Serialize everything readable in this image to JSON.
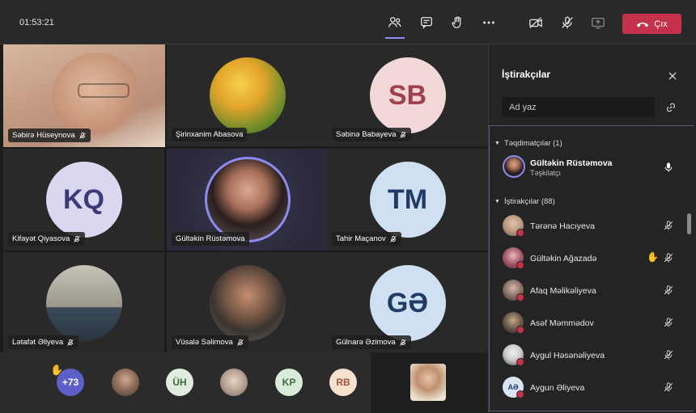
{
  "header": {
    "timer": "01:53:21",
    "leave_label": "Çıx",
    "accent": "#8b8cf0",
    "leave_color": "#c4314b"
  },
  "tiles": [
    {
      "name": "Səbirə Hüseynova",
      "type": "video",
      "color": "#c7a48a"
    },
    {
      "name": "Şirinxanim Abasova",
      "type": "photo",
      "color": "#e3a52a"
    },
    {
      "name": "Səbinə Babayeva",
      "type": "initials",
      "initials": "SB",
      "color": "#f2d7d9",
      "text_color": "#a0404e"
    },
    {
      "name": "Kifayət Qiyasova",
      "type": "initials",
      "initials": "KQ",
      "color": "#dcd7f0",
      "text_color": "#3d3a78"
    },
    {
      "name": "Gültəkin Rüstəmova",
      "type": "photo",
      "color": "#6b4a3e",
      "highlight": true
    },
    {
      "name": "Tahir Maçanov",
      "type": "initials",
      "initials": "TM",
      "color": "#cfe0f2",
      "text_color": "#1f3b66"
    },
    {
      "name": "Lətafət Əliyeva",
      "type": "photo",
      "color": "#b4b0a8"
    },
    {
      "name": "Vüsalə Səlimova",
      "type": "photo",
      "color": "#5a5048"
    },
    {
      "name": "Gülnarə Əzimova",
      "type": "initials",
      "initials": "GƏ",
      "color": "#cfe0f2",
      "text_color": "#1f3b66"
    }
  ],
  "strip": {
    "overflow_count": "+73",
    "avatars": [
      {
        "initials": "",
        "color": "#8a6a58"
      },
      {
        "initials": "ÜH",
        "color": "#e0ece0",
        "text_color": "#3d6b3d"
      },
      {
        "initials": "",
        "color": "#b7a294"
      },
      {
        "initials": "KP",
        "color": "#d9ecd9",
        "text_color": "#3d6b3d"
      },
      {
        "initials": "RB",
        "color": "#f6e1cf",
        "text_color": "#a0553a"
      }
    ]
  },
  "roster": {
    "title": "İştirakçılar",
    "search_placeholder": "Ad yaz",
    "presenters_label": "Təqdimatçılar (1)",
    "presenter": {
      "name": "Gültəkin Rüstəmova",
      "role": "Təşkilatçı"
    },
    "attendees_label": "İştirakçılar (88)",
    "attendees": [
      {
        "name": "Tərানə Hacıyeva",
        "initials": "",
        "color": "#b89a7e",
        "hand": false
      },
      {
        "name": "Gültəkin Ağazadə",
        "initials": "",
        "color": "#a45a6a",
        "hand": true
      },
      {
        "name": "Afaq Məlikəliyeva",
        "initials": "",
        "color": "#8a7068",
        "hand": false
      },
      {
        "name": "Asəf Məmmədov",
        "initials": "",
        "color": "#6a5a4a",
        "hand": false
      },
      {
        "name": "Aygul Həsənəliyeva",
        "initials": "",
        "color": "#c8c8c8",
        "hand": false
      },
      {
        "name": "Aygun Əliyeva",
        "initials": "AƏ",
        "color": "#d8e4f2",
        "text_color": "#1f3b66",
        "hand": false
      }
    ]
  }
}
